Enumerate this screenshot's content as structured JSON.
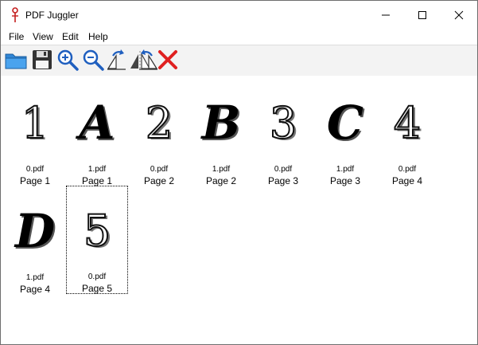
{
  "window": {
    "title": "PDF Juggler"
  },
  "menu": [
    "File",
    "View",
    "Edit",
    "Help"
  ],
  "toolbar": {
    "icons": [
      "open-folder-icon",
      "save-icon",
      "zoom-in-icon",
      "zoom-out-icon",
      "rotate-right-icon",
      "mirror-icon",
      "rotate-left-icon",
      "delete-icon"
    ]
  },
  "pages": [
    {
      "glyph": "1",
      "file": "0.pdf",
      "label": "Page 1"
    },
    {
      "glyph": "A",
      "file": "1.pdf",
      "label": "Page 1"
    },
    {
      "glyph": "2",
      "file": "0.pdf",
      "label": "Page 2"
    },
    {
      "glyph": "B",
      "file": "1.pdf",
      "label": "Page 2"
    },
    {
      "glyph": "3",
      "file": "0.pdf",
      "label": "Page 3"
    },
    {
      "glyph": "C",
      "file": "1.pdf",
      "label": "Page 3"
    },
    {
      "glyph": "4",
      "file": "0.pdf",
      "label": "Page 4"
    },
    {
      "glyph": "D",
      "file": "1.pdf",
      "label": "Page 4"
    },
    {
      "glyph": "5",
      "file": "0.pdf",
      "label": "Page 5"
    }
  ],
  "colors": {
    "delete": "#e02020",
    "folder": "#2f86d6",
    "accent": "#1f5fbf"
  }
}
